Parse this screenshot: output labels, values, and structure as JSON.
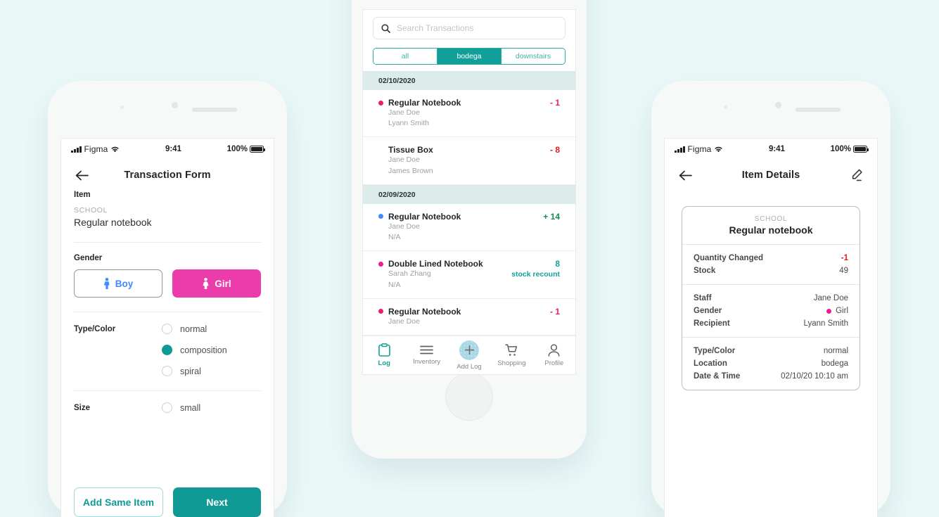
{
  "page": {
    "background": "#eaf8f8"
  },
  "colors": {
    "teal": "#0f9a96",
    "teal_light": "#11a099",
    "pink": "#ec3bab",
    "blue": "#3d8bff",
    "red": "#e01b1b",
    "green": "#1e8a4c",
    "date_header_bg": "#dbeceb",
    "add_circle": "#a8d8e4"
  },
  "status_bar": {
    "carrier": "Figma",
    "time": "9:41",
    "battery_text": "100%"
  },
  "left_phone": {
    "header": {
      "title": "Transaction Form",
      "back_icon": "arrow-left-icon"
    },
    "item_section": {
      "label": "Item",
      "category": "SCHOOL",
      "name": "Regular notebook"
    },
    "gender_section": {
      "label": "Gender",
      "options": [
        {
          "label": "Boy",
          "icon": "male-figure-icon",
          "selected": false
        },
        {
          "label": "Girl",
          "icon": "female-figure-icon",
          "selected": true
        }
      ]
    },
    "type_section": {
      "label": "Type/Color",
      "options": [
        {
          "label": "normal",
          "selected": false
        },
        {
          "label": "composition",
          "selected": true
        },
        {
          "label": "spiral",
          "selected": false
        }
      ]
    },
    "size_section": {
      "label": "Size",
      "options": [
        {
          "label": "small",
          "selected": false
        }
      ]
    },
    "footer": {
      "secondary_label": "Add Same Item",
      "primary_label": "Next"
    }
  },
  "middle_phone": {
    "search": {
      "placeholder": "Search Transactions",
      "value": "",
      "icon": "search-icon"
    },
    "filters": [
      {
        "label": "all",
        "selected": false
      },
      {
        "label": "bodega",
        "selected": true
      },
      {
        "label": "downstairs",
        "selected": false
      }
    ],
    "groups": [
      {
        "date": "02/10/2020",
        "items": [
          {
            "name": "Regular Notebook",
            "staff": "Jane Doe",
            "recipient": "Lyann Smith",
            "amount": "- 1",
            "amount_color": "#ec1b6e",
            "dot_color": "#ec1b6e",
            "note": ""
          },
          {
            "name": "Tissue Box",
            "staff": "Jane Doe",
            "recipient": "James Brown",
            "amount": "- 8",
            "amount_color": "#e01b1b",
            "dot_color": "",
            "note": ""
          }
        ]
      },
      {
        "date": "02/09/2020",
        "items": [
          {
            "name": "Regular Notebook",
            "staff": "Jane Doe",
            "recipient": "N/A",
            "amount": "+ 14",
            "amount_color": "#1e8a4c",
            "dot_color": "#3d8bff",
            "note": ""
          },
          {
            "name": "Double Lined Notebook",
            "staff": "Sarah Zhang",
            "recipient": "N/A",
            "amount": "8",
            "amount_color": "#11a099",
            "dot_color": "#ec1b8f",
            "note": "stock recount"
          },
          {
            "name": "Regular Notebook",
            "staff": "Jane Doe",
            "recipient": "",
            "amount": "- 1",
            "amount_color": "#ec1b6e",
            "dot_color": "#ec1b6e",
            "note": ""
          }
        ]
      }
    ],
    "tabs": [
      {
        "label": "Log",
        "icon": "clipboard-icon",
        "active": true
      },
      {
        "label": "Inventory",
        "icon": "list-icon",
        "active": false
      },
      {
        "label": "Add Log",
        "icon": "plus-icon",
        "active": false
      },
      {
        "label": "Shopping",
        "icon": "cart-icon",
        "active": false
      },
      {
        "label": "Profile",
        "icon": "person-icon",
        "active": false
      }
    ]
  },
  "right_phone": {
    "header": {
      "title": "Item Details",
      "back_icon": "arrow-left-icon",
      "edit_icon": "pencil-icon"
    },
    "card": {
      "category": "SCHOOL",
      "name": "Regular notebook",
      "groups": [
        [
          {
            "key": "Quantity Changed",
            "value": "-1",
            "style": "neg"
          },
          {
            "key": "Stock",
            "value": "49",
            "style": ""
          }
        ],
        [
          {
            "key": "Staff",
            "value": "Jane Doe",
            "style": ""
          },
          {
            "key": "Gender",
            "value": "Girl",
            "style": "girl"
          },
          {
            "key": "Recipient",
            "value": "Lyann Smith",
            "style": ""
          }
        ],
        [
          {
            "key": "Type/Color",
            "value": "normal",
            "style": ""
          },
          {
            "key": "Location",
            "value": "bodega",
            "style": ""
          },
          {
            "key": "Date & Time",
            "value": "02/10/20  10:10 am",
            "style": ""
          }
        ]
      ]
    }
  }
}
